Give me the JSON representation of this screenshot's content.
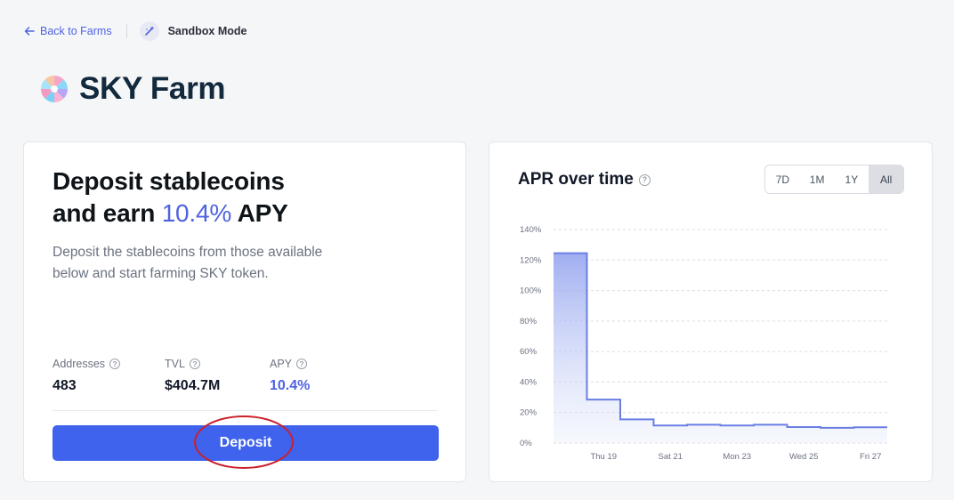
{
  "nav": {
    "back_label": "Back to Farms",
    "sandbox_label": "Sandbox Mode"
  },
  "page": {
    "title": "SKY Farm"
  },
  "deposit_card": {
    "headline_line1": "Deposit stablecoins",
    "headline_prefix": "and earn ",
    "headline_apy": "10.4%",
    "headline_suffix": " APY",
    "description": "Deposit the stablecoins from those available below and start farming SKY token.",
    "stats": [
      {
        "label": "Addresses",
        "value": "483"
      },
      {
        "label": "TVL",
        "value": "$404.7M"
      },
      {
        "label": "APY",
        "value": "10.4%"
      }
    ],
    "deposit_label": "Deposit"
  },
  "apr_card": {
    "title": "APR over time",
    "ranges": [
      "7D",
      "1M",
      "1Y",
      "All"
    ],
    "active_range": "All"
  },
  "colors": {
    "accent": "#4f62e0",
    "button": "#3f63ec",
    "line": "#6b7fe3",
    "highlight": "#cc1f2a"
  },
  "chart_data": {
    "type": "area",
    "step": true,
    "ylim": [
      0,
      140
    ],
    "yticks": [
      "0%",
      "20%",
      "40%",
      "60%",
      "80%",
      "100%",
      "120%",
      "140%"
    ],
    "xticks": [
      "Thu 19",
      "Sat 21",
      "Mon 23",
      "Wed 25",
      "Fri 27"
    ],
    "x": [
      "Wed 18",
      "Thu 19",
      "Fri 20",
      "Sat 21",
      "Sun 22",
      "Mon 23",
      "Tue 24",
      "Wed 25",
      "Thu 26",
      "Fri 27"
    ],
    "series": [
      {
        "values": [
          124.5,
          28.5,
          15.5,
          11.5,
          12,
          11.5,
          12,
          10.5,
          10,
          10.4
        ]
      }
    ],
    "grid": true
  }
}
